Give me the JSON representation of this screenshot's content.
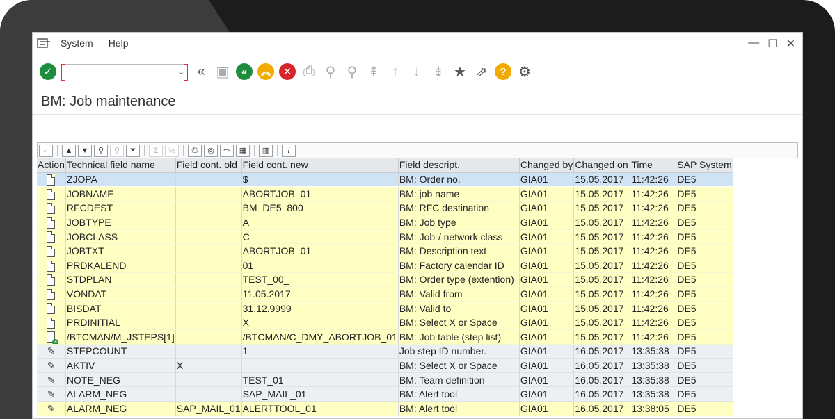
{
  "menu": {
    "items": [
      "System",
      "Help"
    ]
  },
  "window_controls": [
    "—",
    "☐",
    "✕"
  ],
  "toolbar": {
    "command_field": {
      "value": "",
      "placeholder": ""
    }
  },
  "page": {
    "title": "BM: Job maintenance"
  },
  "grid": {
    "columns": [
      "Action",
      "Technical field name",
      "Field cont. old",
      "Field cont. new",
      "Field descript.",
      "Changed by",
      "Changed on",
      "Time",
      "SAP System"
    ],
    "rows": [
      {
        "action": "document-icon",
        "style": "sel",
        "tech": "ZJOPA",
        "old": "",
        "new": "$",
        "desc": "BM: Order no.",
        "by": "GIA01",
        "on": "15.05.2017",
        "time": "11:42:26",
        "sys": "DE5"
      },
      {
        "action": "document-icon",
        "style": "yellow",
        "tech": "JOBNAME",
        "old": "",
        "new": "ABORTJOB_01",
        "desc": "BM: job name",
        "by": "GIA01",
        "on": "15.05.2017",
        "time": "11:42:26",
        "sys": "DE5"
      },
      {
        "action": "document-icon",
        "style": "yellow",
        "tech": "RFCDEST",
        "old": "",
        "new": "BM_DE5_800",
        "desc": "BM: RFC destination",
        "by": "GIA01",
        "on": "15.05.2017",
        "time": "11:42:26",
        "sys": "DE5"
      },
      {
        "action": "document-icon",
        "style": "yellow",
        "tech": "JOBTYPE",
        "old": "",
        "new": "A",
        "desc": "BM: Job type",
        "by": "GIA01",
        "on": "15.05.2017",
        "time": "11:42:26",
        "sys": "DE5"
      },
      {
        "action": "document-icon",
        "style": "yellow",
        "tech": "JOBCLASS",
        "old": "",
        "new": "C",
        "desc": "BM: Job-/ network class",
        "by": "GIA01",
        "on": "15.05.2017",
        "time": "11:42:26",
        "sys": "DE5"
      },
      {
        "action": "document-icon",
        "style": "yellow",
        "tech": "JOBTXT",
        "old": "",
        "new": "ABORTJOB_01",
        "desc": "BM: Description text",
        "by": "GIA01",
        "on": "15.05.2017",
        "time": "11:42:26",
        "sys": "DE5"
      },
      {
        "action": "document-icon",
        "style": "yellow",
        "tech": "PRDKALEND",
        "old": "",
        "new": "01",
        "desc": "BM: Factory calendar ID",
        "by": "GIA01",
        "on": "15.05.2017",
        "time": "11:42:26",
        "sys": "DE5"
      },
      {
        "action": "document-icon",
        "style": "yellow",
        "tech": "STDPLAN",
        "old": "",
        "new": "TEST_00_",
        "desc": "BM: Order type (extention)",
        "by": "GIA01",
        "on": "15.05.2017",
        "time": "11:42:26",
        "sys": "DE5"
      },
      {
        "action": "document-icon",
        "style": "yellow",
        "tech": "VONDAT",
        "old": "",
        "new": "11.05.2017",
        "desc": "BM: Valid from",
        "by": "GIA01",
        "on": "15.05.2017",
        "time": "11:42:26",
        "sys": "DE5"
      },
      {
        "action": "document-icon",
        "style": "yellow",
        "tech": "BISDAT",
        "old": "",
        "new": "31.12.9999",
        "desc": "BM: Valid to",
        "by": "GIA01",
        "on": "15.05.2017",
        "time": "11:42:26",
        "sys": "DE5"
      },
      {
        "action": "document-icon",
        "style": "yellow",
        "tech": "PRDINITIAL",
        "old": "",
        "new": "X",
        "desc": "BM: Select X or Space",
        "by": "GIA01",
        "on": "15.05.2017",
        "time": "11:42:26",
        "sys": "DE5"
      },
      {
        "action": "table-add-icon",
        "style": "yellow",
        "tech": "/BTCMAN/M_JSTEPS[1]",
        "old": "",
        "new": "/BTCMAN/C_DMY_ABORTJOB_01",
        "desc": "BM: Job table (step list)",
        "by": "GIA01",
        "on": "15.05.2017",
        "time": "11:42:26",
        "sys": "DE5"
      },
      {
        "action": "pencil-icon",
        "style": "gray",
        "tech": "STEPCOUNT",
        "old": "",
        "new": "1",
        "desc": "Job step ID number.",
        "by": "GIA01",
        "on": "16.05.2017",
        "time": "13:35:38",
        "sys": "DE5"
      },
      {
        "action": "pencil-icon",
        "style": "gray",
        "tech": "AKTIV",
        "old": "X",
        "new": "",
        "desc": "BM: Select X or Space",
        "by": "GIA01",
        "on": "16.05.2017",
        "time": "13:35:38",
        "sys": "DE5"
      },
      {
        "action": "pencil-icon",
        "style": "gray",
        "tech": "NOTE_NEG",
        "old": "",
        "new": "TEST_01",
        "desc": "BM: Team definition",
        "by": "GIA01",
        "on": "16.05.2017",
        "time": "13:35:38",
        "sys": "DE5"
      },
      {
        "action": "pencil-icon",
        "style": "gray",
        "tech": "ALARM_NEG",
        "old": "",
        "new": "SAP_MAIL_01",
        "desc": "BM: Alert tool",
        "by": "GIA01",
        "on": "16.05.2017",
        "time": "13:35:38",
        "sys": "DE5"
      },
      {
        "action": "pencil-icon",
        "style": "yellow",
        "tech": "ALARM_NEG",
        "old": "SAP_MAIL_01",
        "new": "ALERTTOOL_01",
        "desc": "BM: Alert tool",
        "by": "GIA01",
        "on": "16.05.2017",
        "time": "13:38:05",
        "sys": "DE5"
      }
    ]
  },
  "colors": {
    "accent_green": "#1e8e3e",
    "accent_orange": "#f2a900",
    "accent_red": "#d9242b",
    "row_yellow": "#ffffc4",
    "row_gray": "#edf0f2",
    "row_selected": "#cfe3f5"
  }
}
